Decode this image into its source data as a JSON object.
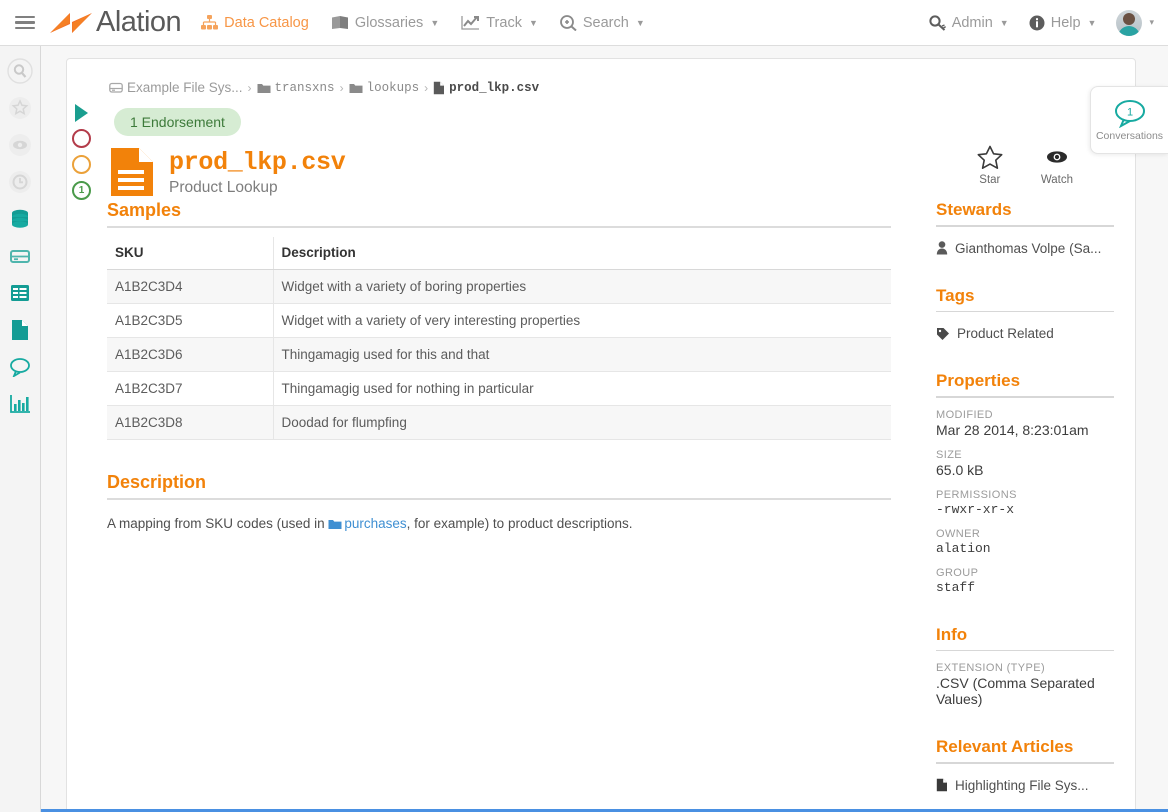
{
  "topnav": {
    "menu_icon": "hamburger-icon",
    "brand": "Alation",
    "items": [
      {
        "label": "Data Catalog",
        "icon": "sitemap-icon",
        "active": true,
        "caret": false
      },
      {
        "label": "Glossaries",
        "icon": "book-icon",
        "active": false,
        "caret": true
      },
      {
        "label": "Track",
        "icon": "chart-line-icon",
        "active": false,
        "caret": true
      },
      {
        "label": "Search",
        "icon": "search-plus-icon",
        "active": false,
        "caret": true
      }
    ],
    "right": [
      {
        "label": "Admin",
        "icon": "key-icon",
        "caret": true
      },
      {
        "label": "Help",
        "icon": "info-circle-icon",
        "caret": true
      }
    ],
    "avatar_caret": "▾"
  },
  "rail": {
    "items": [
      {
        "name": "search-icon"
      },
      {
        "name": "star-icon"
      },
      {
        "name": "eye-icon"
      },
      {
        "name": "clock-icon"
      },
      {
        "name": "database-icon"
      },
      {
        "name": "drive-icon"
      },
      {
        "name": "table-icon"
      },
      {
        "name": "file-icon"
      },
      {
        "name": "comment-icon"
      },
      {
        "name": "bar-chart-icon"
      }
    ]
  },
  "breadcrumb": {
    "root": "Example File Sys...",
    "separator": "›",
    "parts": [
      "transxns",
      "lookups"
    ],
    "current": "prod_lkp.csv"
  },
  "markers": {
    "play": "play-icon",
    "rings": [
      {
        "name": "warning-ring-red",
        "color": "#b33c4a",
        "text": ""
      },
      {
        "name": "warning-ring-amber",
        "color": "#eba13a",
        "text": ""
      },
      {
        "name": "endorsement-ring-green",
        "color": "#4a9a4a",
        "text": "1"
      }
    ]
  },
  "header": {
    "endorsement": "1 Endorsement",
    "title": "prod_lkp.csv",
    "subtitle": "Product Lookup",
    "file_icon": "csv-file-icon"
  },
  "actions": [
    {
      "label": "Star",
      "icon": "star-outline-icon"
    },
    {
      "label": "Watch",
      "icon": "eye-icon"
    }
  ],
  "conversations": {
    "label": "Conversations",
    "count": "1",
    "icon": "speech-bubble-icon"
  },
  "samples": {
    "heading": "Samples",
    "columns": [
      "SKU",
      "Description"
    ],
    "rows": [
      [
        "A1B2C3D4",
        "Widget with a variety of boring properties"
      ],
      [
        "A1B2C3D5",
        "Widget with a variety of very interesting properties"
      ],
      [
        "A1B2C3D6",
        "Thingamagig used for this and that"
      ],
      [
        "A1B2C3D7",
        "Thingamagig used for nothing in particular"
      ],
      [
        "A1B2C3D8",
        "Doodad for flumpfing"
      ]
    ]
  },
  "description": {
    "heading": "Description",
    "text_before": "A mapping from SKU codes (used in ",
    "link": "purchases",
    "link_icon": "folder-icon",
    "text_after": ", for example) to product descriptions."
  },
  "stewards": {
    "heading": "Stewards",
    "items": [
      {
        "name": "Gianthomas Volpe (Sa...",
        "icon": "user-icon"
      }
    ]
  },
  "tags": {
    "heading": "Tags",
    "items": [
      {
        "name": "Product Related",
        "icon": "tag-icon"
      }
    ]
  },
  "properties": {
    "heading": "Properties",
    "fields": [
      {
        "key": "MODIFIED",
        "value": "Mar 28 2014, 8:23:01am",
        "mono": false
      },
      {
        "key": "SIZE",
        "value": "65.0 kB",
        "mono": false
      },
      {
        "key": "PERMISSIONS",
        "value": "-rwxr-xr-x",
        "mono": true
      },
      {
        "key": "OWNER",
        "value": "alation",
        "mono": true
      },
      {
        "key": "GROUP",
        "value": "staff",
        "mono": true
      }
    ]
  },
  "info": {
    "heading": "Info",
    "fields": [
      {
        "key": "EXTENSION (TYPE)",
        "value": ".CSV (Comma Separated Values)"
      }
    ]
  },
  "relevant_articles": {
    "heading": "Relevant Articles",
    "items": [
      {
        "name": "Highlighting File Sys...",
        "icon": "article-icon"
      }
    ]
  },
  "colors": {
    "brand_orange": "#f2820a",
    "nav_inactive": "#9a9a9a",
    "teal": "#1a9e8f",
    "link_blue": "#3f8fd2",
    "endorse_bg": "#d6ecd3",
    "bottom_bar": "#4a90e2"
  }
}
